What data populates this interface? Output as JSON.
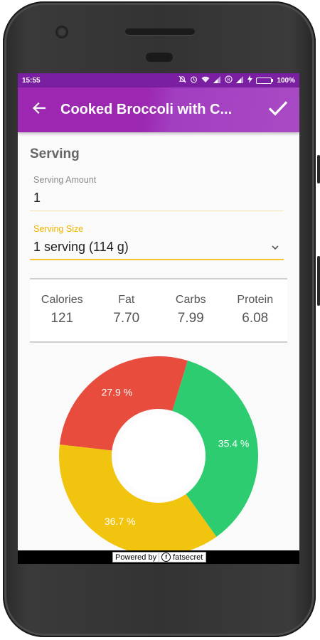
{
  "status_bar": {
    "time": "15:55",
    "battery_text": "100%",
    "battery_level": 1.0,
    "icons": [
      "alarm-off-icon",
      "alarm-icon",
      "wifi-icon",
      "signal-icon",
      "r-circle-icon",
      "signal-icon",
      "charging-icon"
    ]
  },
  "app_bar": {
    "title": "Cooked Broccoli with C...",
    "back_icon": "arrow-left-icon",
    "confirm_icon": "check-icon"
  },
  "serving": {
    "title": "Serving",
    "amount_label": "Serving Amount",
    "amount_value": "1",
    "size_label": "Serving Size",
    "size_value": "1 serving (114 g)"
  },
  "nutrition": [
    {
      "label": "Calories",
      "value": "121"
    },
    {
      "label": "Fat",
      "value": "7.70"
    },
    {
      "label": "Carbs",
      "value": "7.99"
    },
    {
      "label": "Protein",
      "value": "6.08"
    }
  ],
  "chart_data": {
    "type": "pie",
    "donut": true,
    "slices": [
      {
        "label": "35.4 %",
        "value": 35.4,
        "color": "#2ecc71"
      },
      {
        "label": "36.7 %",
        "value": 36.7,
        "color": "#f1c40f"
      },
      {
        "label": "27.9 %",
        "value": 27.9,
        "color": "#e74c3c"
      }
    ]
  },
  "footer": {
    "powered_by": "Powered by",
    "brand": "fatsecret"
  },
  "colors": {
    "primary": "#9c27b0",
    "status_bar": "#7b1fa2",
    "accent": "#f5c52b"
  }
}
